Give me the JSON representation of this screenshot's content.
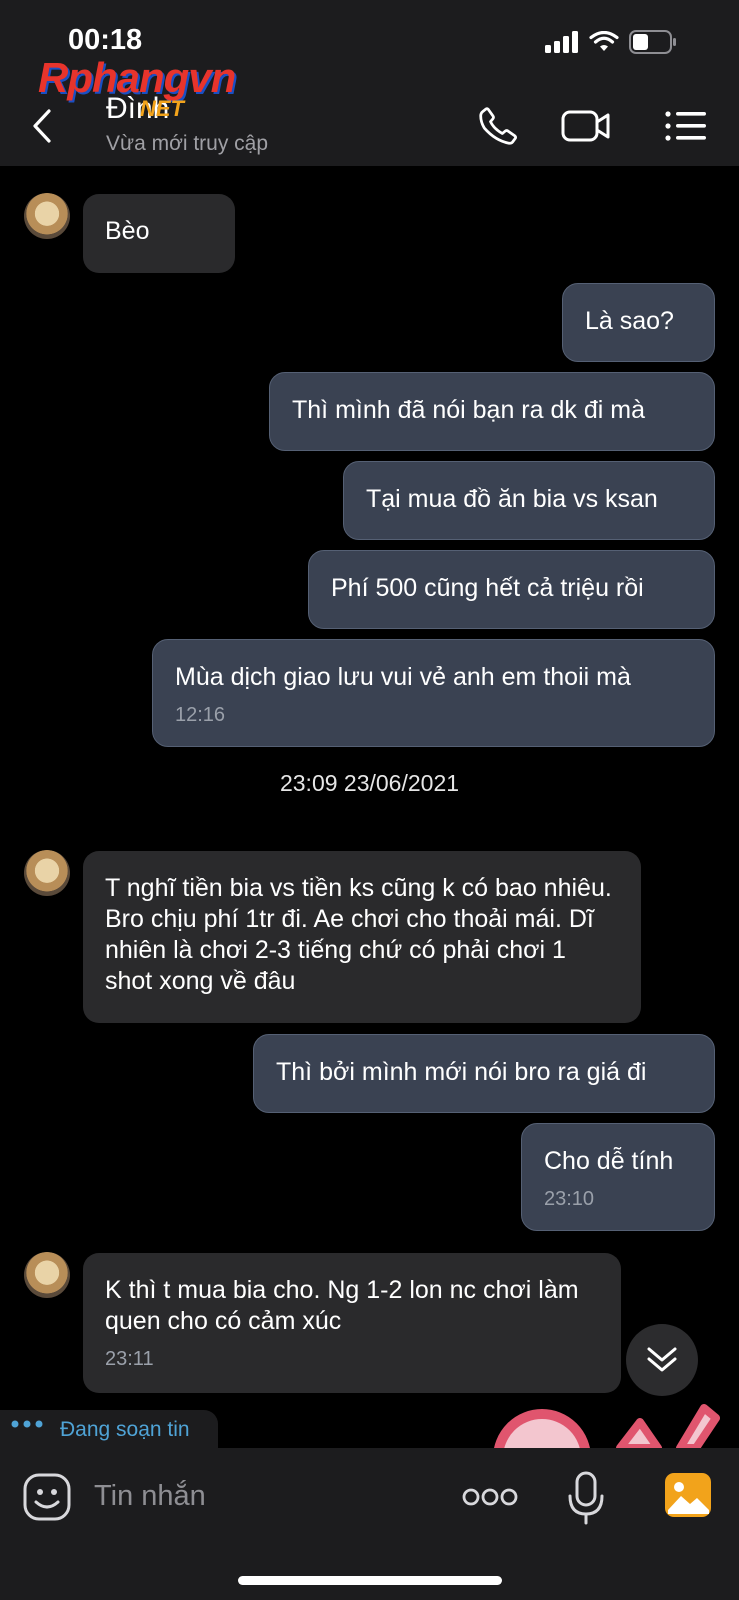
{
  "status_bar": {
    "time": "00:18"
  },
  "watermark": {
    "brand": "Rphangvn",
    "suffix": "NET"
  },
  "header": {
    "contact_name": "Đình",
    "contact_status": "Vừa mới truy cập"
  },
  "messages": [
    {
      "dir": "received",
      "text": "Bèo"
    },
    {
      "dir": "sent",
      "text": "Là sao?"
    },
    {
      "dir": "sent",
      "text": "Thì mình đã nói bạn ra dk đi mà"
    },
    {
      "dir": "sent",
      "text": "Tại mua đồ ăn bia vs ksan"
    },
    {
      "dir": "sent",
      "text": "Phí 500 cũng hết cả triệu rồi"
    },
    {
      "dir": "sent",
      "text": "Mùa dịch giao lưu vui vẻ anh em thoii mà",
      "time": "12:16"
    },
    {
      "dir": "received",
      "text": "T nghĩ tiền bia vs tiền ks cũng k có bao nhiêu. Bro chịu phí 1tr đi. Ae chơi cho thoải mái. Dĩ nhiên là chơi 2-3 tiếng chứ có phải chơi 1 shot xong về đâu"
    },
    {
      "dir": "sent",
      "text": "Thì bởi mình mới nói bro ra giá đi"
    },
    {
      "dir": "sent",
      "text": "Cho dễ tính",
      "time": "23:10"
    },
    {
      "dir": "received",
      "text": "K thì t mua bia cho. Ng 1-2 lon nc chơi làm quen cho có cảm xúc",
      "time": "23:11"
    }
  ],
  "date_separator": "23:09 23/06/2021",
  "typing_indicator": "Đang soạn tin",
  "composer": {
    "placeholder": "Tin nhắn"
  },
  "colors": {
    "background": "#000000",
    "sent_bubble": "#3a4252",
    "received_bubble": "#2a2a2c",
    "accent": "#4fa3d6",
    "gallery": "#f2a31b"
  }
}
